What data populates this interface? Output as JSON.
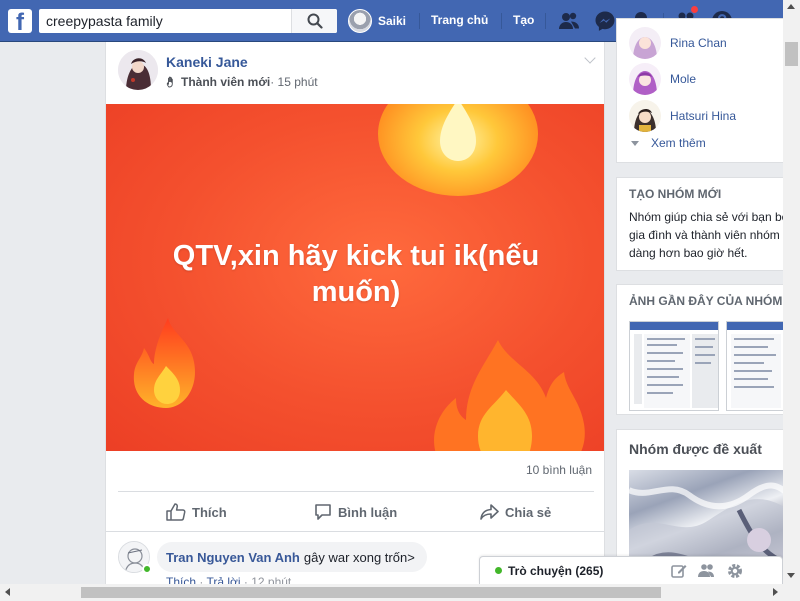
{
  "topbar": {
    "search_value": "creepypasta family",
    "profile_name": "Saiki",
    "nav_home": "Trang chủ",
    "nav_create": "Tạo",
    "brand_color": "#4267b2"
  },
  "post": {
    "author": "Kaneki Jane",
    "role": "Thành viên mới",
    "time": " · 15 phút",
    "banner_text": "QTV,xin hãy kick tui ik(nếu muốn)",
    "comments_count": "10 bình luận",
    "actions": {
      "like": "Thích",
      "comment": "Bình luận",
      "share": "Chia sẻ"
    },
    "comment": {
      "author": "Tran Nguyen Van Anh",
      "text": "gây war xong trốn>",
      "like": "Thích",
      "sep": " · ",
      "reply": "Trả lời",
      "time": " · 12 phút"
    }
  },
  "sidebar": {
    "members": [
      {
        "name": "Rina Chan"
      },
      {
        "name": "Mole"
      },
      {
        "name": "Hatsuri Hina"
      }
    ],
    "see_more": "Xem thêm",
    "create_group": {
      "title": "TẠO NHÓM MỚI",
      "body": "Nhóm giúp chia sẻ với bạn bè, gia đình và thành viên nhóm dễ dàng hơn bao giờ hết."
    },
    "recent_photos": {
      "title": "ẢNH GẦN ĐÂY CỦA NHÓM"
    },
    "suggested": {
      "title": "Nhóm được đề xuất"
    }
  },
  "chat": {
    "label": "Trò chuyện (265)"
  }
}
